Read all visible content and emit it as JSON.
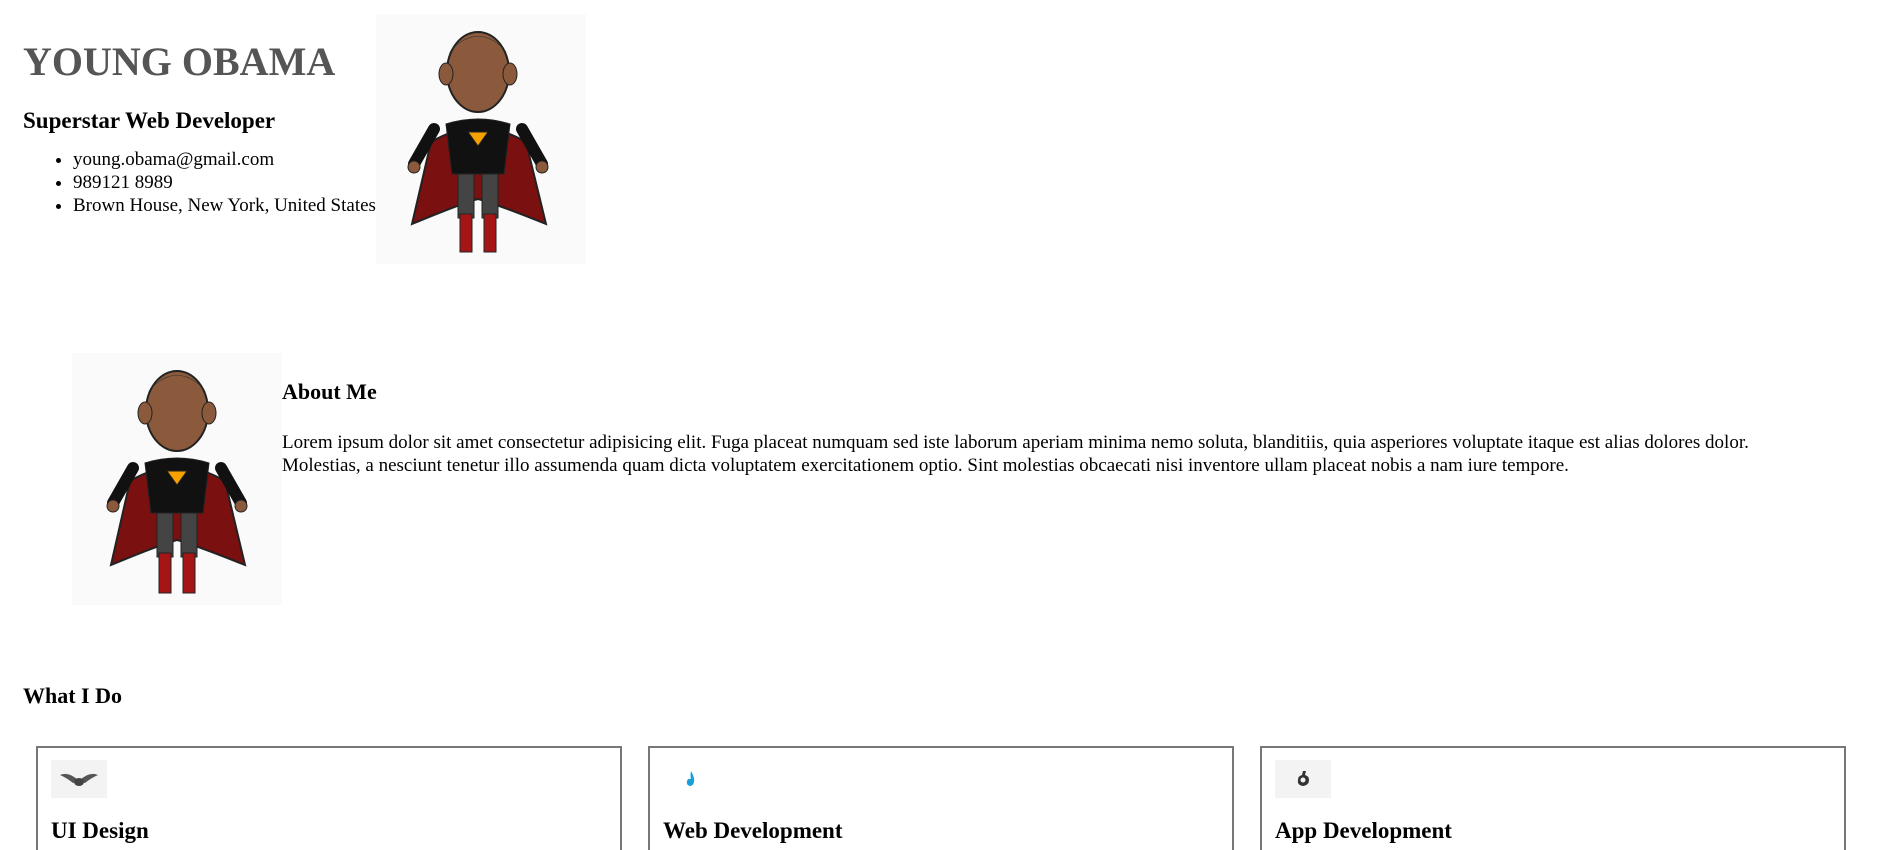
{
  "profile": {
    "name": "YOUNG OBAMA",
    "role": "Superstar Web Developer",
    "contact": [
      "young.obama@gmail.com",
      "989121 8989",
      "Brown House, New York, United States"
    ]
  },
  "about": {
    "title": "About Me",
    "body": "Lorem ipsum dolor sit amet consectetur adipisicing elit. Fuga placeat numquam sed iste laborum aperiam minima nemo soluta, blanditiis, quia asperiores voluptate itaque est alias dolores dolor. Molestias, a nesciunt tenetur illo assumenda quam dicta voluptatem exercitationem optio. Sint molestias obcaecati nisi inventore ullam placeat nobis a nam iure tempore."
  },
  "services": {
    "title": "What I Do",
    "items": [
      {
        "name": "UI Design",
        "icon": "wings-icon"
      },
      {
        "name": "Web Development",
        "icon": "flame-icon"
      },
      {
        "name": "App Development",
        "icon": "gear-icon"
      }
    ]
  }
}
